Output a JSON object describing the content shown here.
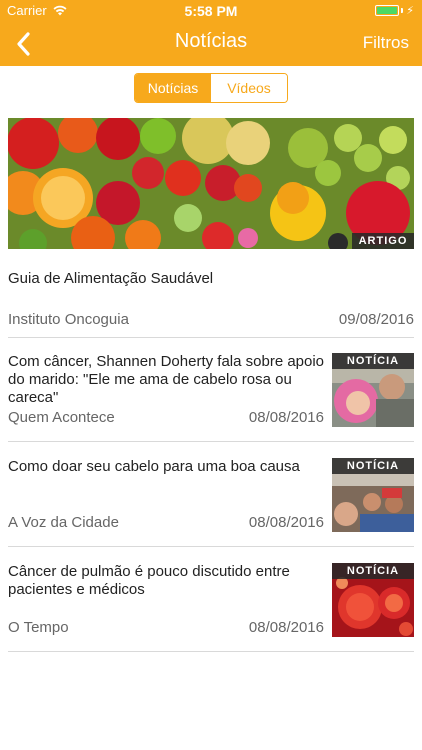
{
  "status": {
    "carrier": "Carrier",
    "time": "5:58 PM"
  },
  "nav": {
    "title": "Notícias",
    "filter_label": "Filtros"
  },
  "segments": [
    {
      "label": "Notícias",
      "active": true
    },
    {
      "label": "Vídeos",
      "active": false
    }
  ],
  "featured": {
    "tag": "ARTIGO",
    "title": "Guia de Alimentação Saudável",
    "source": "Instituto Oncoguia",
    "date": "09/08/2016"
  },
  "news": [
    {
      "tag": "NOTÍCIA",
      "title": "Com câncer, Shannen Doherty fala sobre apoio do marido: \"Ele me ama de cabelo rosa ou careca\"",
      "source": "Quem Acontece",
      "date": "08/08/2016"
    },
    {
      "tag": "NOTÍCIA",
      "title": "Como doar seu cabelo para uma boa causa",
      "source": "A Voz da Cidade",
      "date": "08/08/2016"
    },
    {
      "tag": "NOTÍCIA",
      "title": "Câncer de pulmão é pouco discutido entre pacientes e médicos",
      "source": "O Tempo",
      "date": "08/08/2016"
    }
  ],
  "colors": {
    "accent": "#f7a91c",
    "tag_bg": "#282828",
    "battery": "#4cd964"
  },
  "icons": {
    "back": "chevron-left-icon",
    "wifi": "wifi-icon",
    "battery": "battery-icon"
  }
}
